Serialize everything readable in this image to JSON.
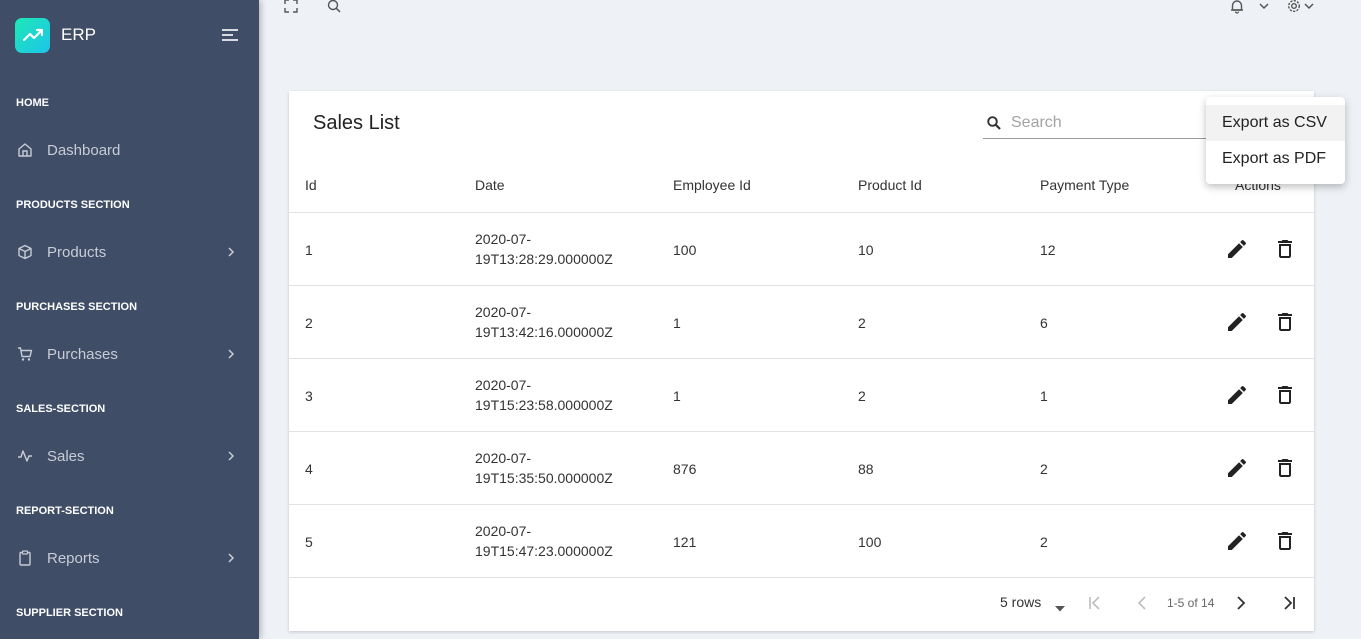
{
  "sidebar": {
    "brand": "ERP",
    "sections": [
      {
        "label": "HOME",
        "item": "Dashboard",
        "icon": "home-icon",
        "has_children": false
      },
      {
        "label": "PRODUCTS SECTION",
        "item": "Products",
        "icon": "box-icon",
        "has_children": true
      },
      {
        "label": "PURCHASES SECTION",
        "item": "Purchases",
        "icon": "cart-icon",
        "has_children": true
      },
      {
        "label": "SALES-SECTION",
        "item": "Sales",
        "icon": "activity-icon",
        "has_children": true
      },
      {
        "label": "REPORT-SECTION",
        "item": "Reports",
        "icon": "clipboard-icon",
        "has_children": true
      },
      {
        "label": "SUPPLIER SECTION"
      }
    ]
  },
  "topbar": {
    "icons": [
      "fullscreen-icon",
      "search-icon",
      "bell-icon",
      "chevron-down-icon",
      "gear-icon"
    ]
  },
  "table": {
    "title": "Sales List",
    "search_placeholder": "Search",
    "columns": [
      "Id",
      "Date",
      "Employee Id",
      "Product Id",
      "Payment Type",
      "Actions"
    ],
    "rows": [
      {
        "id": "1",
        "date_line1": "2020-07-",
        "date_line2": "19T13:28:29.000000Z",
        "employee_id": "100",
        "product_id": "10",
        "payment_type": "12"
      },
      {
        "id": "2",
        "date_line1": "2020-07-",
        "date_line2": "19T13:42:16.000000Z",
        "employee_id": "1",
        "product_id": "2",
        "payment_type": "6"
      },
      {
        "id": "3",
        "date_line1": "2020-07-",
        "date_line2": "19T15:23:58.000000Z",
        "employee_id": "1",
        "product_id": "2",
        "payment_type": "1"
      },
      {
        "id": "4",
        "date_line1": "2020-07-",
        "date_line2": "19T15:35:50.000000Z",
        "employee_id": "876",
        "product_id": "88",
        "payment_type": "2"
      },
      {
        "id": "5",
        "date_line1": "2020-07-",
        "date_line2": "19T15:47:23.000000Z",
        "employee_id": "121",
        "product_id": "100",
        "payment_type": "2"
      }
    ],
    "pagination": {
      "rows_per_page": "5 rows",
      "range_text": "1-5 of 14"
    }
  },
  "export_menu": {
    "items": [
      "Export as CSV",
      "Export as PDF"
    ]
  },
  "colors": {
    "sidebar_bg": "#3f4d67",
    "accent_gradient_start": "#1de9b6",
    "accent_gradient_end": "#1dc4e9"
  }
}
